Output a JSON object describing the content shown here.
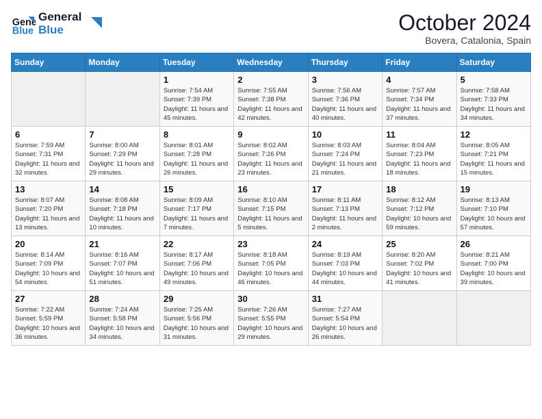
{
  "header": {
    "logo_line1": "General",
    "logo_line2": "Blue",
    "month": "October 2024",
    "location": "Bovera, Catalonia, Spain"
  },
  "days_of_week": [
    "Sunday",
    "Monday",
    "Tuesday",
    "Wednesday",
    "Thursday",
    "Friday",
    "Saturday"
  ],
  "weeks": [
    [
      {
        "day": "",
        "info": ""
      },
      {
        "day": "",
        "info": ""
      },
      {
        "day": "1",
        "info": "Sunrise: 7:54 AM\nSunset: 7:39 PM\nDaylight: 11 hours and 45 minutes."
      },
      {
        "day": "2",
        "info": "Sunrise: 7:55 AM\nSunset: 7:38 PM\nDaylight: 11 hours and 42 minutes."
      },
      {
        "day": "3",
        "info": "Sunrise: 7:56 AM\nSunset: 7:36 PM\nDaylight: 11 hours and 40 minutes."
      },
      {
        "day": "4",
        "info": "Sunrise: 7:57 AM\nSunset: 7:34 PM\nDaylight: 11 hours and 37 minutes."
      },
      {
        "day": "5",
        "info": "Sunrise: 7:58 AM\nSunset: 7:33 PM\nDaylight: 11 hours and 34 minutes."
      }
    ],
    [
      {
        "day": "6",
        "info": "Sunrise: 7:59 AM\nSunset: 7:31 PM\nDaylight: 11 hours and 32 minutes."
      },
      {
        "day": "7",
        "info": "Sunrise: 8:00 AM\nSunset: 7:29 PM\nDaylight: 11 hours and 29 minutes."
      },
      {
        "day": "8",
        "info": "Sunrise: 8:01 AM\nSunset: 7:28 PM\nDaylight: 11 hours and 26 minutes."
      },
      {
        "day": "9",
        "info": "Sunrise: 8:02 AM\nSunset: 7:26 PM\nDaylight: 11 hours and 23 minutes."
      },
      {
        "day": "10",
        "info": "Sunrise: 8:03 AM\nSunset: 7:24 PM\nDaylight: 11 hours and 21 minutes."
      },
      {
        "day": "11",
        "info": "Sunrise: 8:04 AM\nSunset: 7:23 PM\nDaylight: 11 hours and 18 minutes."
      },
      {
        "day": "12",
        "info": "Sunrise: 8:05 AM\nSunset: 7:21 PM\nDaylight: 11 hours and 15 minutes."
      }
    ],
    [
      {
        "day": "13",
        "info": "Sunrise: 8:07 AM\nSunset: 7:20 PM\nDaylight: 11 hours and 13 minutes."
      },
      {
        "day": "14",
        "info": "Sunrise: 8:08 AM\nSunset: 7:18 PM\nDaylight: 11 hours and 10 minutes."
      },
      {
        "day": "15",
        "info": "Sunrise: 8:09 AM\nSunset: 7:17 PM\nDaylight: 11 hours and 7 minutes."
      },
      {
        "day": "16",
        "info": "Sunrise: 8:10 AM\nSunset: 7:15 PM\nDaylight: 11 hours and 5 minutes."
      },
      {
        "day": "17",
        "info": "Sunrise: 8:11 AM\nSunset: 7:13 PM\nDaylight: 11 hours and 2 minutes."
      },
      {
        "day": "18",
        "info": "Sunrise: 8:12 AM\nSunset: 7:12 PM\nDaylight: 10 hours and 59 minutes."
      },
      {
        "day": "19",
        "info": "Sunrise: 8:13 AM\nSunset: 7:10 PM\nDaylight: 10 hours and 57 minutes."
      }
    ],
    [
      {
        "day": "20",
        "info": "Sunrise: 8:14 AM\nSunset: 7:09 PM\nDaylight: 10 hours and 54 minutes."
      },
      {
        "day": "21",
        "info": "Sunrise: 8:16 AM\nSunset: 7:07 PM\nDaylight: 10 hours and 51 minutes."
      },
      {
        "day": "22",
        "info": "Sunrise: 8:17 AM\nSunset: 7:06 PM\nDaylight: 10 hours and 49 minutes."
      },
      {
        "day": "23",
        "info": "Sunrise: 8:18 AM\nSunset: 7:05 PM\nDaylight: 10 hours and 46 minutes."
      },
      {
        "day": "24",
        "info": "Sunrise: 8:19 AM\nSunset: 7:03 PM\nDaylight: 10 hours and 44 minutes."
      },
      {
        "day": "25",
        "info": "Sunrise: 8:20 AM\nSunset: 7:02 PM\nDaylight: 10 hours and 41 minutes."
      },
      {
        "day": "26",
        "info": "Sunrise: 8:21 AM\nSunset: 7:00 PM\nDaylight: 10 hours and 39 minutes."
      }
    ],
    [
      {
        "day": "27",
        "info": "Sunrise: 7:22 AM\nSunset: 5:59 PM\nDaylight: 10 hours and 36 minutes."
      },
      {
        "day": "28",
        "info": "Sunrise: 7:24 AM\nSunset: 5:58 PM\nDaylight: 10 hours and 34 minutes."
      },
      {
        "day": "29",
        "info": "Sunrise: 7:25 AM\nSunset: 5:56 PM\nDaylight: 10 hours and 31 minutes."
      },
      {
        "day": "30",
        "info": "Sunrise: 7:26 AM\nSunset: 5:55 PM\nDaylight: 10 hours and 29 minutes."
      },
      {
        "day": "31",
        "info": "Sunrise: 7:27 AM\nSunset: 5:54 PM\nDaylight: 10 hours and 26 minutes."
      },
      {
        "day": "",
        "info": ""
      },
      {
        "day": "",
        "info": ""
      }
    ]
  ]
}
